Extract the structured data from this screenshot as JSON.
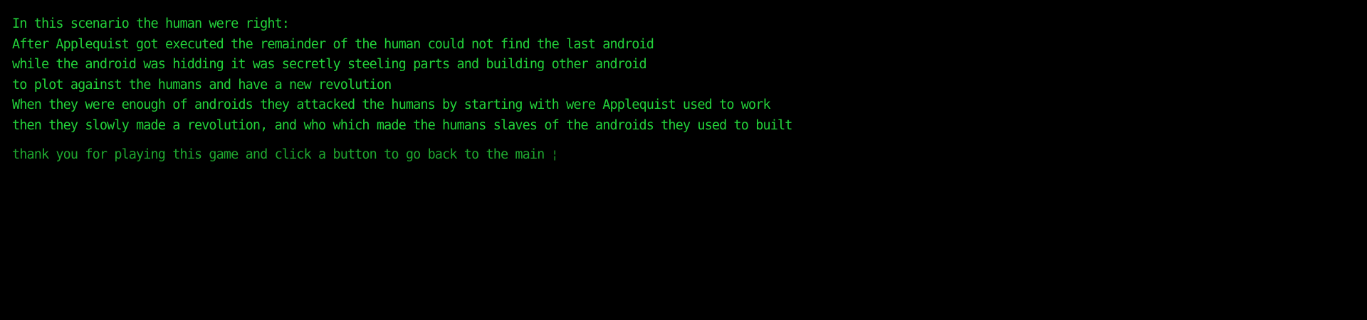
{
  "terminal": {
    "text_color": "#23d23a",
    "prompt_color": "#1fa82f",
    "background_color": "#000000",
    "story_lines": [
      "In this scenario the human were right:",
      "After Applequist got executed the remainder of the human could not find the last android",
      "while the android was hidding it was secretly steeling parts and building other android",
      "to plot against the humans and have a new revolution",
      "When they were enough of androids they attacked the humans by starting with were Applequist used to work",
      "then they slowly made a revolution, and who which made the humans slaves of the androids they used to built"
    ],
    "prompt": "thank you for playing this game and click a button to go back to the main",
    "cursor_glyph": "¦"
  }
}
